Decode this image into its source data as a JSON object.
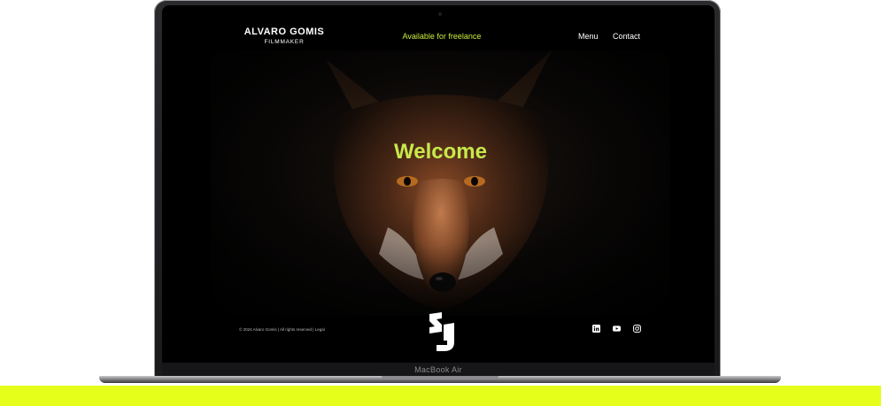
{
  "site": {
    "brand": {
      "name": "ALVARO GOMIS",
      "role": "FILMMAKER"
    },
    "availability": "Available for freelance",
    "nav": {
      "menu": "Menu",
      "contact": "Contact"
    },
    "hero": {
      "headline": "Welcome"
    },
    "footer": {
      "copyright": "© 2024 Alvaro Gomis | All rights reserved | Legal",
      "logo_icon": "ag-monogram-logo",
      "social_icons": [
        "linkedin-icon",
        "youtube-icon",
        "instagram-icon"
      ]
    }
  },
  "device": {
    "label": "MacBook Air"
  },
  "colors": {
    "accent": "#c8e84b",
    "floor": "#e5ff1a",
    "background": "#000000"
  }
}
